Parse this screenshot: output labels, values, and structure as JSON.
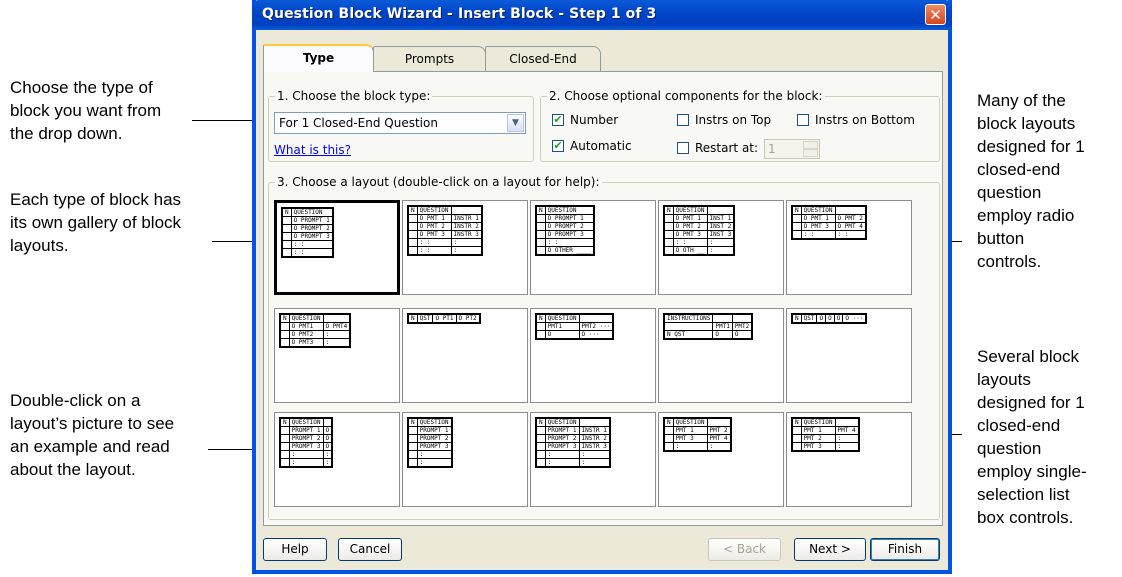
{
  "callouts": {
    "choose_type": [
      "Choose the type of",
      "block you want from",
      "the drop down."
    ],
    "gallery": [
      "Each type of block has",
      "its own gallery of block",
      "layouts."
    ],
    "double_click": [
      "Double-click on a",
      "layout’s picture to see",
      "an example and read",
      "about the layout."
    ],
    "radio_layouts": [
      "Many of the",
      "block layouts",
      "designed for 1",
      "closed-end",
      "question",
      "employ radio",
      "button",
      "controls."
    ],
    "listbox_layouts": [
      "Several block",
      "layouts",
      "designed for 1",
      "closed-end",
      "question",
      "employ single-",
      "selection list",
      "box controls."
    ]
  },
  "dialog": {
    "title": "Question Block Wizard - Insert Block - Step 1 of 3",
    "close_glyph": "✕",
    "tabs": [
      "Type",
      "Prompts",
      "Closed-End"
    ],
    "active_tab": "Type",
    "group1_label": "1. Choose the block type:",
    "block_type_value": "For 1 Closed-End Question",
    "combo_arrow": "▼",
    "what_link": "What is this?",
    "group2_label": "2. Choose optional components for the block:",
    "check_number": "Number",
    "check_automatic": "Automatic",
    "check_instrs_top": "Instrs on Top",
    "check_instrs_bottom": "Instrs on Bottom",
    "check_restart": "Restart at:",
    "restart_value": "1",
    "checked_mark": "✔",
    "group3_label": "3. Choose a layout (double-click on a layout for help):",
    "buttons": {
      "help": "Help",
      "cancel": "Cancel",
      "back": "< Back",
      "next": "Next >",
      "finish": "Finish"
    }
  },
  "layouts": {
    "row1": [
      {
        "rows": [
          [
            "N",
            "QUESTION"
          ],
          [
            "",
            "O PROMPT 1"
          ],
          [
            "",
            "O PROMPT 2"
          ],
          [
            "",
            "O PROMPT 3"
          ],
          [
            "",
            ":   :"
          ],
          [
            "",
            ":   :"
          ]
        ]
      },
      {
        "rows": [
          [
            "N",
            "QUESTION",
            ""
          ],
          [
            "",
            "O PMT 1",
            "INSTR 1"
          ],
          [
            "",
            "O PMT 2",
            "INSTR 2"
          ],
          [
            "",
            "O PMT 3",
            "INSTR 3"
          ],
          [
            "",
            ":  :",
            ":"
          ],
          [
            "",
            ":  :",
            ":"
          ]
        ]
      },
      {
        "rows": [
          [
            "N",
            "QUESTION"
          ],
          [
            "",
            "O PROMPT 1"
          ],
          [
            "",
            "O PROMPT 2"
          ],
          [
            "",
            "O PROMPT 3"
          ],
          [
            "",
            ":   :"
          ],
          [
            "",
            "O OTHER ____"
          ]
        ]
      },
      {
        "rows": [
          [
            "N",
            "QUESTION",
            ""
          ],
          [
            "",
            "O PMT 1",
            "INST 1"
          ],
          [
            "",
            "O PMT 2",
            "INST 2"
          ],
          [
            "",
            "O PMT 3",
            "INST 3"
          ],
          [
            "",
            ":  :",
            ":"
          ],
          [
            "",
            "O OTH __",
            ":"
          ]
        ]
      },
      {
        "rows": [
          [
            "N",
            "QUESTION",
            ""
          ],
          [
            "",
            "O PMT 1",
            "O PMT 2"
          ],
          [
            "",
            "O PMT 3",
            "O PMT 4"
          ],
          [
            "",
            ":  :",
            ":  :"
          ]
        ]
      }
    ],
    "row2": [
      {
        "rows": [
          [
            "N",
            "QUESTION",
            ""
          ],
          [
            "",
            "O PMT1",
            "O PMT4"
          ],
          [
            "",
            "O PMT2",
            ":"
          ],
          [
            "",
            "O PMT3",
            ":"
          ]
        ]
      },
      {
        "rows": [
          [
            "N",
            "QST",
            "O PT1",
            "O PT2"
          ]
        ]
      },
      {
        "rows": [
          [
            "N",
            "QUESTION",
            ""
          ],
          [
            "",
            "PMT1",
            "PMT2 ···"
          ],
          [
            "",
            "O",
            "O ···"
          ]
        ]
      },
      {
        "rows": [
          [
            "INSTRUCTIONS",
            "",
            ""
          ],
          [
            "",
            "PMT1",
            "PMT2"
          ],
          [
            "N QST",
            "O",
            "O"
          ]
        ]
      },
      {
        "rows": [
          [
            "N",
            "QST",
            "O",
            "O",
            "O",
            "O ···"
          ]
        ]
      }
    ],
    "row3": [
      {
        "rows": [
          [
            "N",
            "QUESTION",
            ""
          ],
          [
            "",
            "PROMPT 1",
            "O"
          ],
          [
            "",
            "PROMPT 2",
            "O"
          ],
          [
            "",
            "PROMPT 3",
            "O"
          ],
          [
            "",
            ":",
            ":"
          ],
          [
            "",
            ":",
            ":"
          ]
        ]
      },
      {
        "rows": [
          [
            "N",
            "QUESTION"
          ],
          [
            "",
            "PROMPT 1"
          ],
          [
            "",
            "PROMPT 2"
          ],
          [
            "",
            "PROMPT 3"
          ],
          [
            "",
            ":"
          ],
          [
            "",
            ":"
          ]
        ]
      },
      {
        "rows": [
          [
            "N",
            "QUESTION",
            ""
          ],
          [
            "",
            "PROMPT 1",
            "INSTR 1"
          ],
          [
            "",
            "PROMPT 2",
            "INSTR 2"
          ],
          [
            "",
            "PROMPT 3",
            "INSTR 3"
          ],
          [
            "",
            ":",
            ":"
          ],
          [
            "",
            ":",
            ":"
          ]
        ]
      },
      {
        "rows": [
          [
            "N",
            "QUESTION",
            ""
          ],
          [
            "",
            "PMT 1",
            "PMT 2"
          ],
          [
            "",
            "PMT 3",
            "PMT 4"
          ],
          [
            "",
            ":",
            ":"
          ]
        ]
      },
      {
        "rows": [
          [
            "N",
            "QUESTION",
            ""
          ],
          [
            "",
            "PMT 1",
            "PMT 4"
          ],
          [
            "",
            "PMT 2",
            ":"
          ],
          [
            "",
            "PMT 3",
            ":"
          ]
        ]
      }
    ]
  }
}
